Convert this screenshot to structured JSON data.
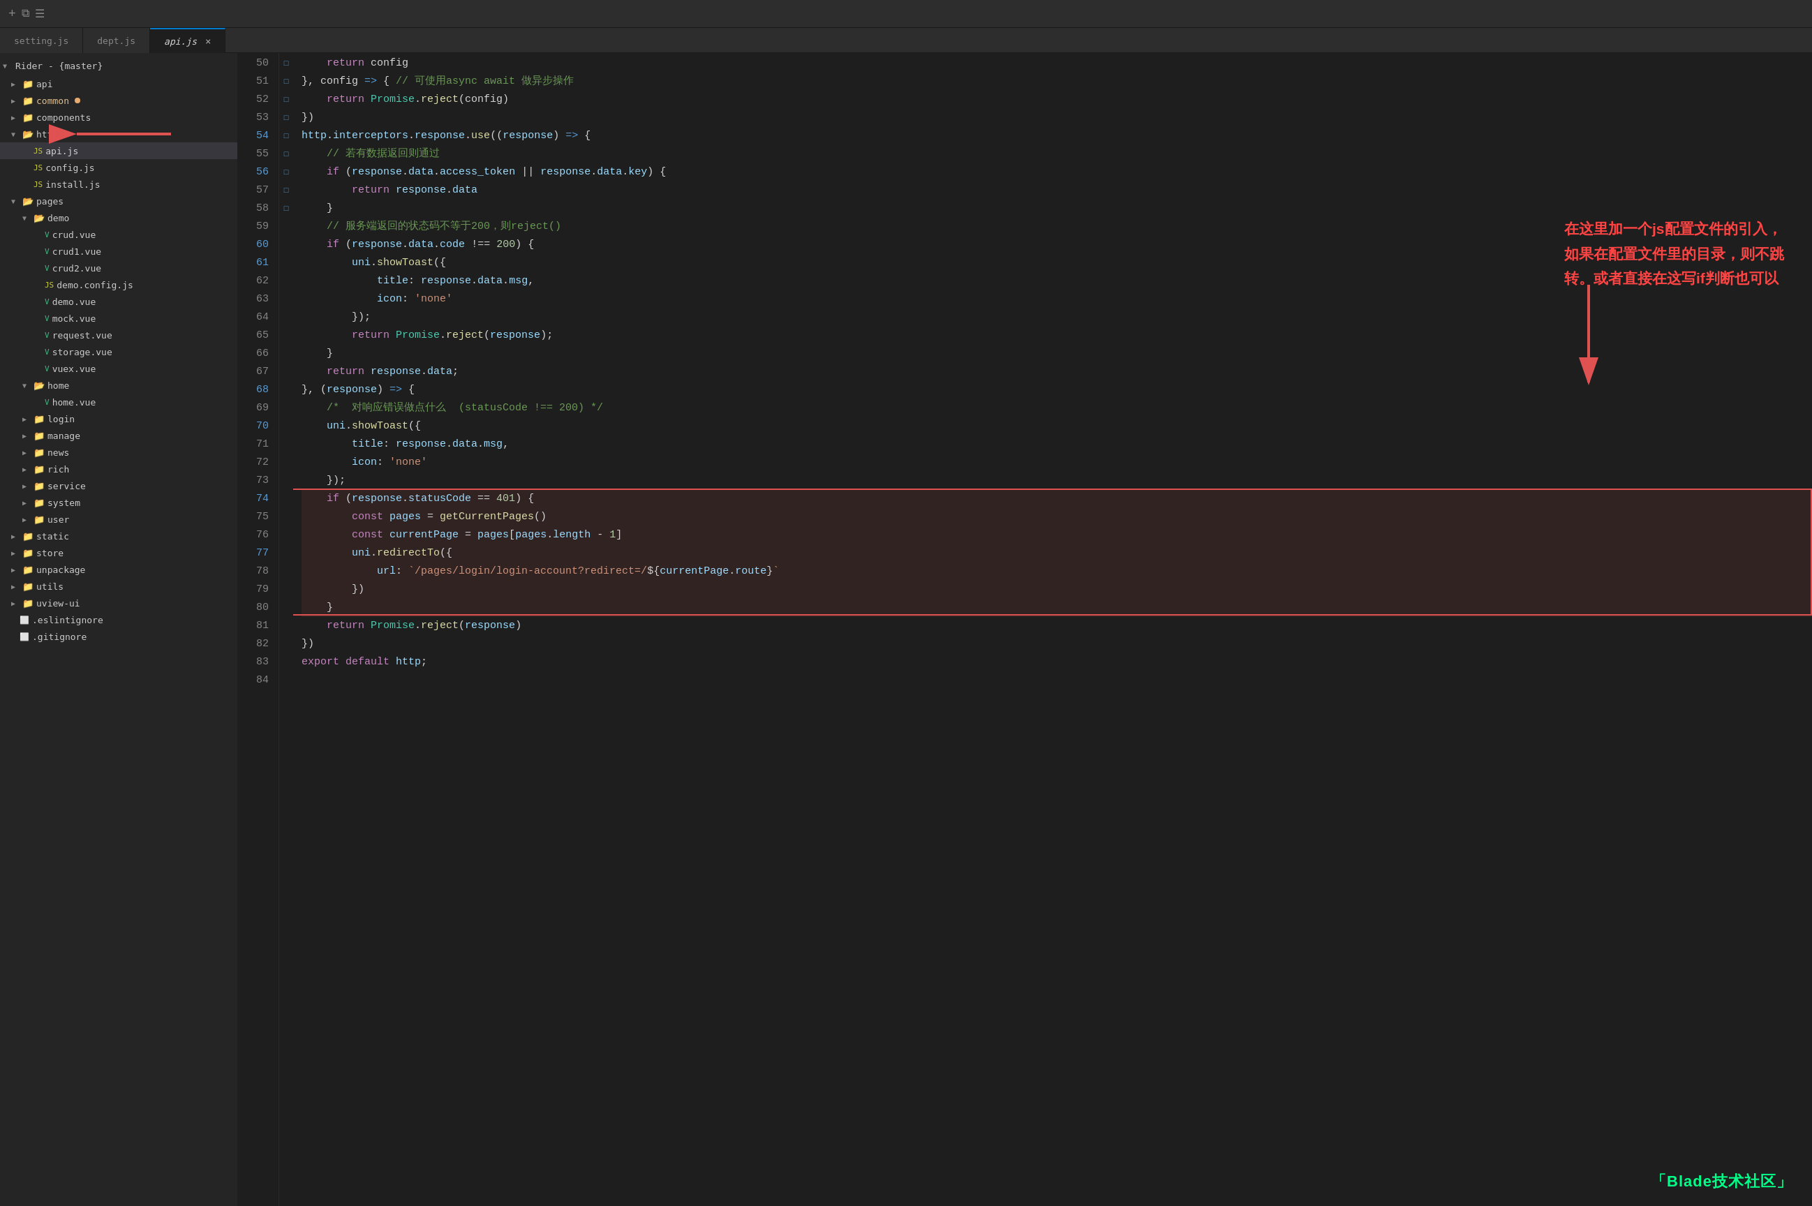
{
  "app": {
    "title": "Rider - {master}"
  },
  "tabs": [
    {
      "label": "setting.js",
      "active": false,
      "closeable": false
    },
    {
      "label": "dept.js",
      "active": false,
      "closeable": false
    },
    {
      "label": "api.js",
      "active": true,
      "closeable": true
    }
  ],
  "sidebar": {
    "root_label": "Rider - {master}",
    "items": [
      {
        "level": 1,
        "type": "folder",
        "label": "api",
        "open": false
      },
      {
        "level": 1,
        "type": "folder",
        "label": "common",
        "open": false,
        "highlighted": true
      },
      {
        "level": 1,
        "type": "folder",
        "label": "components",
        "open": false
      },
      {
        "level": 1,
        "type": "folder",
        "label": "http",
        "open": true
      },
      {
        "level": 2,
        "type": "file-js",
        "label": "api.js",
        "selected": true
      },
      {
        "level": 2,
        "type": "file-js",
        "label": "config.js"
      },
      {
        "level": 2,
        "type": "file-js",
        "label": "install.js"
      },
      {
        "level": 1,
        "type": "folder",
        "label": "pages",
        "open": true
      },
      {
        "level": 2,
        "type": "folder",
        "label": "demo",
        "open": true
      },
      {
        "level": 3,
        "type": "file-vue",
        "label": "crud.vue"
      },
      {
        "level": 3,
        "type": "file-vue",
        "label": "crud1.vue"
      },
      {
        "level": 3,
        "type": "file-vue",
        "label": "crud2.vue"
      },
      {
        "level": 3,
        "type": "file-js",
        "label": "demo.config.js"
      },
      {
        "level": 3,
        "type": "file-vue",
        "label": "demo.vue"
      },
      {
        "level": 3,
        "type": "file-vue",
        "label": "mock.vue"
      },
      {
        "level": 3,
        "type": "file-vue",
        "label": "request.vue"
      },
      {
        "level": 3,
        "type": "file-vue",
        "label": "storage.vue"
      },
      {
        "level": 3,
        "type": "file-vue",
        "label": "vuex.vue"
      },
      {
        "level": 2,
        "type": "folder",
        "label": "home",
        "open": true
      },
      {
        "level": 3,
        "type": "file-vue",
        "label": "home.vue"
      },
      {
        "level": 2,
        "type": "folder",
        "label": "login",
        "open": false
      },
      {
        "level": 2,
        "type": "folder",
        "label": "manage",
        "open": false
      },
      {
        "level": 2,
        "type": "folder",
        "label": "news",
        "open": false
      },
      {
        "level": 2,
        "type": "folder",
        "label": "rich",
        "open": false
      },
      {
        "level": 2,
        "type": "folder",
        "label": "service",
        "open": false
      },
      {
        "level": 2,
        "type": "folder",
        "label": "system",
        "open": false
      },
      {
        "level": 2,
        "type": "folder",
        "label": "user",
        "open": false
      },
      {
        "level": 1,
        "type": "folder",
        "label": "static",
        "open": false
      },
      {
        "level": 1,
        "type": "folder",
        "label": "store",
        "open": false
      },
      {
        "level": 1,
        "type": "folder",
        "label": "unpackage",
        "open": false
      },
      {
        "level": 1,
        "type": "folder",
        "label": "utils",
        "open": false
      },
      {
        "level": 1,
        "type": "folder",
        "label": "uview-ui",
        "open": false
      },
      {
        "level": 1,
        "type": "file-js",
        "label": ".eslintignore"
      },
      {
        "level": 1,
        "type": "file-js",
        "label": ".gitignore"
      }
    ]
  },
  "annotation": {
    "text": "在这里加一个js配置文件的引入，\n如果在配置文件里的目录，则不跳\n转。或者直接在这写if判断也可以"
  },
  "watermark": "「Blade技术社区」",
  "code_lines": [
    {
      "num": 50,
      "content": "    return config"
    },
    {
      "num": 51,
      "content": "}, config => { // 可使用async await 做异步操作"
    },
    {
      "num": 52,
      "content": "    return Promise.reject(config)"
    },
    {
      "num": 53,
      "content": "})"
    },
    {
      "num": 54,
      "content": "http.interceptors.response.use((response) => {"
    },
    {
      "num": 55,
      "content": "    // 若有数据返回则通过"
    },
    {
      "num": 56,
      "content": "    if (response.data.access_token || response.data.key) {"
    },
    {
      "num": 57,
      "content": "        return response.data"
    },
    {
      "num": 58,
      "content": "    }"
    },
    {
      "num": 59,
      "content": "    // 服务端返回的状态码不等于200，则reject()"
    },
    {
      "num": 60,
      "content": "    if (response.data.code !== 200) {"
    },
    {
      "num": 61,
      "content": "        uni.showToast({"
    },
    {
      "num": 62,
      "content": "            title: response.data.msg,"
    },
    {
      "num": 63,
      "content": "            icon: 'none'"
    },
    {
      "num": 64,
      "content": "        });"
    },
    {
      "num": 65,
      "content": "        return Promise.reject(response);"
    },
    {
      "num": 66,
      "content": "    }"
    },
    {
      "num": 67,
      "content": "    return response.data;"
    },
    {
      "num": 68,
      "content": "}, (response) => {"
    },
    {
      "num": 69,
      "content": "    /*  对响应错误做点什么  (statusCode !== 200) */"
    },
    {
      "num": 70,
      "content": "    uni.showToast({"
    },
    {
      "num": 71,
      "content": "        title: response.data.msg,"
    },
    {
      "num": 72,
      "content": "        icon: 'none'"
    },
    {
      "num": 73,
      "content": "    });"
    },
    {
      "num": 74,
      "content": "    if (response.statusCode == 401) {"
    },
    {
      "num": 75,
      "content": "        const pages = getCurrentPages()"
    },
    {
      "num": 76,
      "content": "        const currentPage = pages[pages.length - 1]"
    },
    {
      "num": 77,
      "content": "        uni.redirectTo({"
    },
    {
      "num": 78,
      "content": "            url: `/pages/login/login-account?redirect=/${currentPage.route}`"
    },
    {
      "num": 79,
      "content": "        })"
    },
    {
      "num": 80,
      "content": "    }"
    },
    {
      "num": 81,
      "content": "    return Promise.reject(response)"
    },
    {
      "num": 82,
      "content": "})"
    },
    {
      "num": 83,
      "content": "export default http;"
    },
    {
      "num": 84,
      "content": ""
    }
  ]
}
